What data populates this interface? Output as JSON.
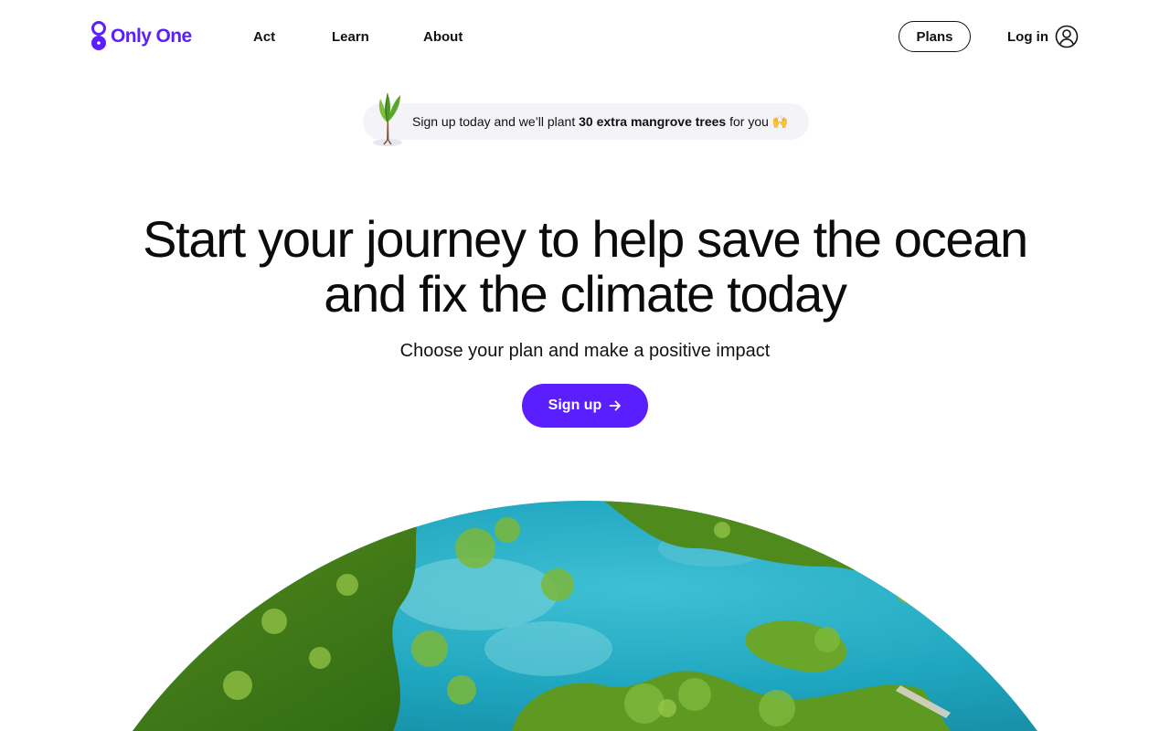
{
  "brand": {
    "name": "Only One",
    "color": "#5b1fff"
  },
  "nav": {
    "items": [
      "Act",
      "Learn",
      "About"
    ],
    "plans_label": "Plans",
    "login_label": "Log in",
    "user_icon": "user-icon"
  },
  "promo": {
    "icon": "mangrove-tree-icon",
    "text_before": "Sign up today and we’ll plant ",
    "text_bold": "30 extra mangrove trees",
    "text_after": " for you 🙌"
  },
  "hero": {
    "title_line1": "Start your journey to help save the ocean",
    "title_line2": "and fix the climate today",
    "subtitle": "Choose your plan and make a positive impact",
    "cta_label": "Sign up",
    "cta_icon": "arrow-right-icon"
  },
  "image": {
    "subject": "aerial-mangrove-coastline"
  }
}
